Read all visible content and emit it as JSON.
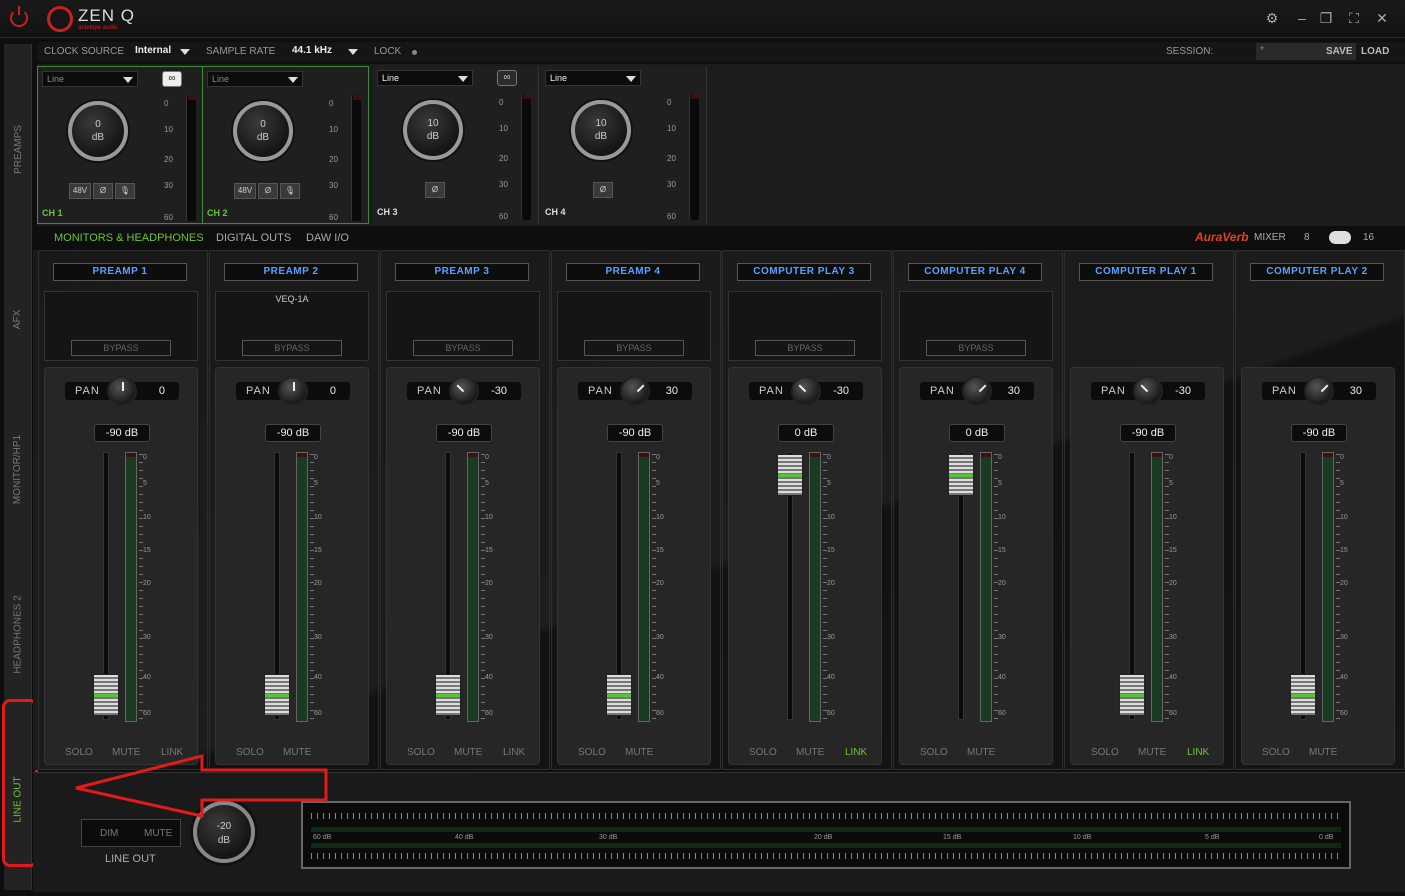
{
  "app": {
    "logo": "ZEN Q",
    "logo_sub": "antelope audio"
  },
  "topbar": {
    "clock_source_label": "CLOCK SOURCE",
    "clock_source_value": "Internal",
    "sample_rate_label": "SAMPLE RATE",
    "sample_rate_value": "44.1 kHz",
    "lock_label": "LOCK",
    "session_label": "SESSION:",
    "session_value": "*",
    "save_label": "SAVE",
    "load_label": "LOAD"
  },
  "sidebar": {
    "tabs": [
      "PREAMPS",
      "AFX",
      "MONITOR/HP1",
      "HEADPHONES 2",
      "LINE OUT"
    ]
  },
  "preamps": [
    {
      "input": "Line",
      "gain": "0",
      "unit": "dB",
      "name": "CH 1",
      "buttons": [
        "48V",
        "Ø",
        "mic-icon"
      ]
    },
    {
      "input": "Line",
      "gain": "0",
      "unit": "dB",
      "name": "CH 2",
      "buttons": [
        "48V",
        "Ø",
        "mic-icon"
      ]
    },
    {
      "input": "Line",
      "gain": "10",
      "unit": "dB",
      "name": "CH 3",
      "buttons": [
        "Ø"
      ]
    },
    {
      "input": "Line",
      "gain": "10",
      "unit": "dB",
      "name": "CH 4",
      "buttons": [
        "Ø"
      ]
    }
  ],
  "preamp_scale": [
    "0",
    "10",
    "20",
    "30",
    "60"
  ],
  "sections": {
    "monitors": "MONITORS & HEADPHONES",
    "digital_outs": "DIGITAL OUTS",
    "daw_io": "DAW I/O",
    "auraverb": "AuraVerb",
    "mixer_label": "MIXER",
    "mixer_a": "8",
    "mixer_b": "16"
  },
  "channels": [
    {
      "name": "PREAMP 1",
      "fx": "",
      "bypass": "BYPASS",
      "pan": "0",
      "level": "-90 dB",
      "link": "LINK",
      "link_on": false
    },
    {
      "name": "PREAMP 2",
      "fx": "VEQ-1A",
      "bypass": "BYPASS",
      "pan": "0",
      "level": "-90 dB",
      "link": "",
      "link_on": false
    },
    {
      "name": "PREAMP 3",
      "fx": "",
      "bypass": "BYPASS",
      "pan": "-30",
      "level": "-90 dB",
      "link": "LINK",
      "link_on": false
    },
    {
      "name": "PREAMP 4",
      "fx": "",
      "bypass": "BYPASS",
      "pan": "30",
      "level": "-90 dB",
      "link": "",
      "link_on": false
    },
    {
      "name": "COMPUTER PLAY 3",
      "fx": "",
      "bypass": "BYPASS",
      "pan": "-30",
      "level": "0 dB",
      "link": "LINK",
      "link_on": true
    },
    {
      "name": "COMPUTER PLAY 4",
      "fx": "",
      "bypass": "BYPASS",
      "pan": "30",
      "level": "0 dB",
      "link": "",
      "link_on": false
    },
    {
      "name": "COMPUTER PLAY 1",
      "fx": "",
      "bypass": "",
      "pan": "-30",
      "level": "-90 dB",
      "link": "LINK",
      "link_on": true
    },
    {
      "name": "COMPUTER PLAY 2",
      "fx": "",
      "bypass": "",
      "pan": "30",
      "level": "-90 dB",
      "link": "",
      "link_on": false
    }
  ],
  "channel_footer": {
    "solo": "SOLO",
    "mute": "MUTE"
  },
  "fader_scale": [
    "0",
    "5",
    "10",
    "15",
    "20",
    "30",
    "40",
    "60"
  ],
  "lineout": {
    "dim": "DIM",
    "mute": "MUTE",
    "label": "LINE OUT",
    "gain": "-20",
    "unit": "dB",
    "scale": [
      "60 dB",
      "40 dB",
      "30 dB",
      "20 dB",
      "15 dB",
      "10 dB",
      "5 dB",
      "0 dB"
    ]
  },
  "colors": {
    "accent_green": "#6ec437",
    "name_blue": "#5aa0ff",
    "brand_red": "#c8201b",
    "annotation_red": "#e11a1a"
  }
}
